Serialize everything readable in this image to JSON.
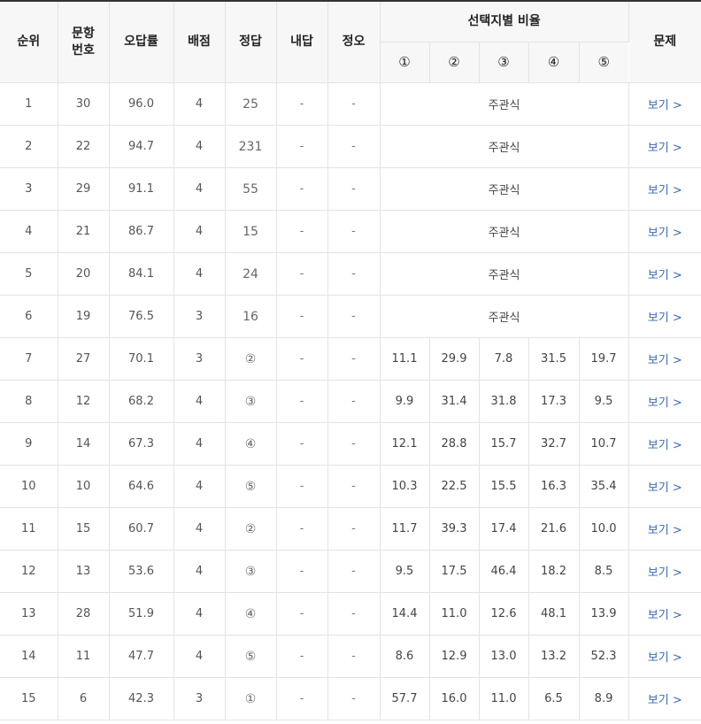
{
  "table": {
    "headers": {
      "rank": "순위",
      "question_no_line1": "문항",
      "question_no_line2": "번호",
      "error_rate": "오답률",
      "points": "배점",
      "answer": "정답",
      "my_answer": "내답",
      "correct_wrong": "정오",
      "choice_ratio": "선택지별 비율",
      "problem": "문제",
      "choices": [
        "①",
        "②",
        "③",
        "④",
        "⑤"
      ]
    },
    "subjective_label": "주관식",
    "view_label": "보기 >",
    "rows": [
      {
        "rank": "1",
        "q": "30",
        "err": "96.0",
        "pts": "4",
        "ans": "25",
        "mine": "-",
        "ox": "-",
        "type": "subjective",
        "ratios": []
      },
      {
        "rank": "2",
        "q": "22",
        "err": "94.7",
        "pts": "4",
        "ans": "231",
        "mine": "-",
        "ox": "-",
        "type": "subjective",
        "ratios": []
      },
      {
        "rank": "3",
        "q": "29",
        "err": "91.1",
        "pts": "4",
        "ans": "55",
        "mine": "-",
        "ox": "-",
        "type": "subjective",
        "ratios": []
      },
      {
        "rank": "4",
        "q": "21",
        "err": "86.7",
        "pts": "4",
        "ans": "15",
        "mine": "-",
        "ox": "-",
        "type": "subjective",
        "ratios": []
      },
      {
        "rank": "5",
        "q": "20",
        "err": "84.1",
        "pts": "4",
        "ans": "24",
        "mine": "-",
        "ox": "-",
        "type": "subjective",
        "ratios": []
      },
      {
        "rank": "6",
        "q": "19",
        "err": "76.5",
        "pts": "3",
        "ans": "16",
        "mine": "-",
        "ox": "-",
        "type": "subjective",
        "ratios": []
      },
      {
        "rank": "7",
        "q": "27",
        "err": "70.1",
        "pts": "3",
        "ans": "②",
        "mine": "-",
        "ox": "-",
        "type": "mcq",
        "ratios": [
          "11.1",
          "29.9",
          "7.8",
          "31.5",
          "19.7"
        ]
      },
      {
        "rank": "8",
        "q": "12",
        "err": "68.2",
        "pts": "4",
        "ans": "③",
        "mine": "-",
        "ox": "-",
        "type": "mcq",
        "ratios": [
          "9.9",
          "31.4",
          "31.8",
          "17.3",
          "9.5"
        ]
      },
      {
        "rank": "9",
        "q": "14",
        "err": "67.3",
        "pts": "4",
        "ans": "④",
        "mine": "-",
        "ox": "-",
        "type": "mcq",
        "ratios": [
          "12.1",
          "28.8",
          "15.7",
          "32.7",
          "10.7"
        ]
      },
      {
        "rank": "10",
        "q": "10",
        "err": "64.6",
        "pts": "4",
        "ans": "⑤",
        "mine": "-",
        "ox": "-",
        "type": "mcq",
        "ratios": [
          "10.3",
          "22.5",
          "15.5",
          "16.3",
          "35.4"
        ]
      },
      {
        "rank": "11",
        "q": "15",
        "err": "60.7",
        "pts": "4",
        "ans": "②",
        "mine": "-",
        "ox": "-",
        "type": "mcq",
        "ratios": [
          "11.7",
          "39.3",
          "17.4",
          "21.6",
          "10.0"
        ]
      },
      {
        "rank": "12",
        "q": "13",
        "err": "53.6",
        "pts": "4",
        "ans": "③",
        "mine": "-",
        "ox": "-",
        "type": "mcq",
        "ratios": [
          "9.5",
          "17.5",
          "46.4",
          "18.2",
          "8.5"
        ]
      },
      {
        "rank": "13",
        "q": "28",
        "err": "51.9",
        "pts": "4",
        "ans": "④",
        "mine": "-",
        "ox": "-",
        "type": "mcq",
        "ratios": [
          "14.4",
          "11.0",
          "12.6",
          "48.1",
          "13.9"
        ]
      },
      {
        "rank": "14",
        "q": "11",
        "err": "47.7",
        "pts": "4",
        "ans": "⑤",
        "mine": "-",
        "ox": "-",
        "type": "mcq",
        "ratios": [
          "8.6",
          "12.9",
          "13.0",
          "13.2",
          "52.3"
        ]
      },
      {
        "rank": "15",
        "q": "6",
        "err": "42.3",
        "pts": "3",
        "ans": "①",
        "mine": "-",
        "ox": "-",
        "type": "mcq",
        "ratios": [
          "57.7",
          "16.0",
          "11.0",
          "6.5",
          "8.9"
        ]
      }
    ]
  },
  "colors": {
    "link": "#3a6ab3",
    "header_bg": "#f7f7f7",
    "border": "#e3e3e3",
    "top_border": "#333333"
  }
}
